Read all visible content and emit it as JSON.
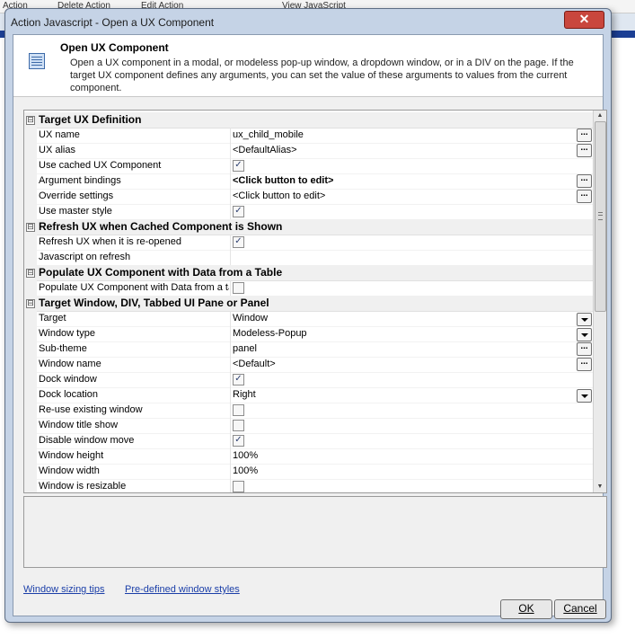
{
  "background": {
    "toolbar_items": [
      "Action",
      "Delete Action",
      "Edit Action",
      "View JavaScript"
    ]
  },
  "window": {
    "title": "Action Javascript - Open a UX Component",
    "close_glyph": "✕"
  },
  "header": {
    "icon": "form-grid-icon",
    "title": "Open UX Component",
    "description": "Open a UX component in a modal, or modeless pop-up window, a dropdown window, or in a DIV on the page. If the target UX component defines any arguments, you can set the value of these arguments to values from the current component."
  },
  "properties": [
    {
      "type": "category",
      "label": "Target UX Definition",
      "toggle": "⊟"
    },
    {
      "type": "prop",
      "name": "UX name",
      "value": "ux_child_mobile",
      "button": "ellipsis"
    },
    {
      "type": "prop",
      "name": "UX alias",
      "value": "<DefaultAlias>",
      "button": "ellipsis"
    },
    {
      "type": "prop",
      "name": "Use cached UX Component",
      "checkbox": true
    },
    {
      "type": "prop",
      "name": "Argument bindings",
      "value": "<Click button to edit>",
      "bold": true,
      "button": "ellipsis"
    },
    {
      "type": "prop",
      "name": "Override settings",
      "value": "<Click button to edit>",
      "button": "ellipsis"
    },
    {
      "type": "prop",
      "name": "Use master style",
      "checkbox": true
    },
    {
      "type": "category",
      "label": "Refresh UX when Cached Component is Shown",
      "toggle": "⊟"
    },
    {
      "type": "prop",
      "name": "Refresh UX when it is re-opened",
      "checkbox": true
    },
    {
      "type": "prop",
      "name": "Javascript on refresh",
      "value": ""
    },
    {
      "type": "category",
      "label": "Populate UX Component with Data from a Table",
      "toggle": "⊟"
    },
    {
      "type": "prop",
      "name": "Populate UX Component with Data from a ta",
      "checkbox": false
    },
    {
      "type": "category",
      "label": "Target Window, DIV, Tabbed UI Pane or Panel",
      "toggle": "⊟"
    },
    {
      "type": "prop",
      "name": "Target",
      "value": "Window",
      "button": "dropdown"
    },
    {
      "type": "prop",
      "name": "Window type",
      "value": "Modeless-Popup",
      "button": "dropdown"
    },
    {
      "type": "prop",
      "name": "Sub-theme",
      "value": "panel",
      "button": "ellipsis"
    },
    {
      "type": "prop",
      "name": "Window name",
      "value": "<Default>",
      "button": "ellipsis"
    },
    {
      "type": "prop",
      "name": "Dock window",
      "checkbox": true
    },
    {
      "type": "prop",
      "name": "Dock location",
      "value": "Right",
      "button": "dropdown"
    },
    {
      "type": "prop",
      "name": "Re-use existing window",
      "checkbox": false
    },
    {
      "type": "prop",
      "name": "Window title show",
      "checkbox": false
    },
    {
      "type": "prop",
      "name": "Disable window move",
      "checkbox": true
    },
    {
      "type": "prop",
      "name": "Window height",
      "value": "100%"
    },
    {
      "type": "prop",
      "name": "Window width",
      "value": "100%"
    },
    {
      "type": "prop",
      "name": "Window is resizable",
      "checkbox": false
    }
  ],
  "glyphs": {
    "ellipsis": "...",
    "check": "✓",
    "scroll_up": "▲",
    "scroll_down": "▼"
  },
  "links": {
    "sizing_tips": "Window sizing tips",
    "predefined_styles": "Pre-defined window styles"
  },
  "buttons": {
    "ok": "OK",
    "cancel": "Cancel"
  },
  "colors": {
    "window_frame": "#c5d3e6",
    "close_button": "#c9463d",
    "link": "#1a3ea8",
    "background_bar": "#1c3f94"
  }
}
